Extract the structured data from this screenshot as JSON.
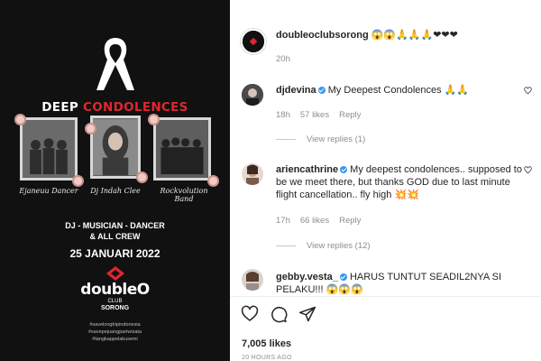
{
  "post_image": {
    "title_part1": "DEEP ",
    "title_part2": "CONDOLENCES",
    "captions": [
      "Ejaneuu Dancer",
      "Dj Indah Clee",
      "Rockvolution Band"
    ],
    "roles_line1": "DJ - MUSICIAN - DANCER",
    "roles_line2": "& ALL CREW",
    "date": "25 JANUARI 2022",
    "brand": "doubleO",
    "brand_sub1": "CLUB",
    "brand_sub2": "SORONG",
    "hashtags": [
      "#savelongtripindonesia",
      "#savepejuangpariwisata",
      "#tangkappelakusemi"
    ]
  },
  "post": {
    "author": "doubleoclubsorong",
    "caption_emojis": "😱😱🙏🙏🙏❤❤❤",
    "time": "20h"
  },
  "comments": [
    {
      "username": "djdevina",
      "verified": true,
      "text": "My Deepest Condolences 🙏🙏",
      "time": "18h",
      "likes": "57 likes",
      "reply_label": "Reply",
      "view_replies": "View replies (1)"
    },
    {
      "username": "ariencathrine",
      "verified": true,
      "text": "My deepest condolences.. supposed to be we meet there, but thanks GOD due to last minute flight cancellation.. fly high 💥💥",
      "time": "17h",
      "likes": "66 likes",
      "reply_label": "Reply",
      "view_replies": "View replies (12)"
    },
    {
      "username": "gebby.vesta_",
      "verified": true,
      "text": "HARUS TUNTUT SEADIL2NYA SI PELAKU!!! 😱😱😱"
    }
  ],
  "likes_count": "7,005 likes",
  "posted_ago": "20 HOURS AGO",
  "icons": [
    "heart-icon",
    "comment-icon",
    "share-icon",
    "like-comment-icon",
    "verified-badge-icon"
  ],
  "colors": {
    "accent_red": "#e0262e",
    "verified_blue": "#3897f0",
    "muted": "#8e8e8e"
  }
}
